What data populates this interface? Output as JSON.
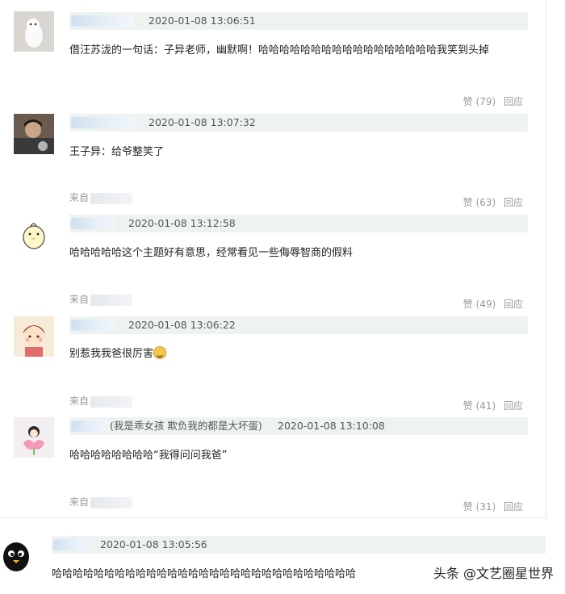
{
  "comments": [
    {
      "timestamp": "2020-01-08 13:06:51",
      "text": "借汪苏泷的一句话：子异老师，幽默啊！哈哈哈哈哈哈哈哈哈哈哈哈哈哈哈哈哈我笑到头掉",
      "source_prefix": "",
      "like_label": "赞",
      "like_count": "(79)",
      "reply_label": "回应"
    },
    {
      "timestamp": "2020-01-08 13:07:32",
      "text": "王子异：给爷整笑了",
      "source_prefix": "来自",
      "like_label": "赞",
      "like_count": "(63)",
      "reply_label": "回应"
    },
    {
      "timestamp": "2020-01-08 13:12:58",
      "text": "哈哈哈哈哈这个主题好有意思，经常看见一些侮辱智商的假料",
      "source_prefix": "来自",
      "like_label": "赞",
      "like_count": "(49)",
      "reply_label": "回应"
    },
    {
      "timestamp": "2020-01-08 13:06:22",
      "text": "别惹我我爸很厉害",
      "source_prefix": "来自",
      "like_label": "赞",
      "like_count": "(41)",
      "reply_label": "回应"
    },
    {
      "username_suffix": "(我是乖女孩 欺负我的都是大坏蛋)",
      "timestamp": "2020-01-08 13:10:08",
      "text": "哈哈哈哈哈哈哈哈“我得问问我爸”",
      "source_prefix": "来自",
      "like_label": "赞",
      "like_count": "(31)",
      "reply_label": "回应"
    }
  ],
  "bottom_post": {
    "timestamp": "2020-01-08 13:05:56",
    "text": "哈哈哈哈哈哈哈哈哈哈哈哈哈哈哈哈哈哈哈哈哈哈哈哈哈哈哈哈哈"
  },
  "watermark": "头条 @文艺圈星世界",
  "colors": {
    "meta_bar": "#eef3f2",
    "muted_text": "#999999",
    "body_text": "#222222"
  }
}
